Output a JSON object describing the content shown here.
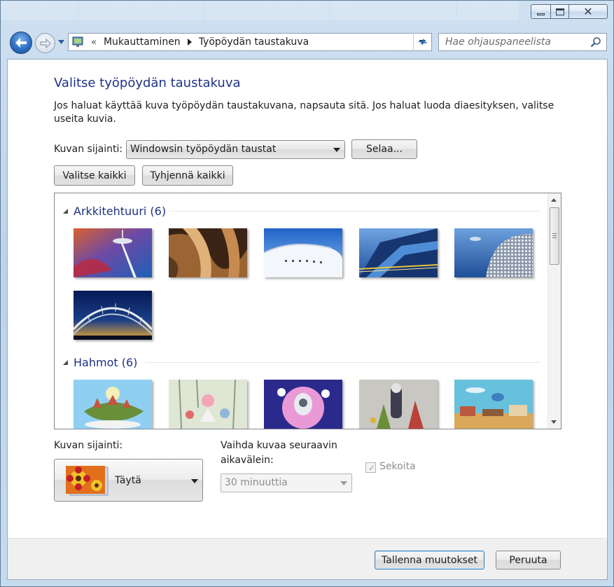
{
  "window": {
    "breadcrumb": [
      "Mukauttaminen",
      "Työpöydän taustakuva"
    ],
    "breadcrumb_overflow": "«",
    "search_placeholder": "Hae ohjauspaneelista"
  },
  "header": {
    "title": "Valitse työpöydän taustakuva",
    "description": "Jos haluat käyttää kuva työpöydän taustakuvana, napsauta sitä. Jos haluat luoda diaesityksen, valitse useita kuvia."
  },
  "location": {
    "label": "Kuvan sijainti:",
    "selected": "Windowsin työpöydän taustat",
    "browse_label": "Selaa..."
  },
  "selection": {
    "select_all": "Valitse kaikki",
    "clear_all": "Tyhjennä kaikki"
  },
  "gallery": {
    "groups": [
      {
        "title": "Arkkitehtuuri (6)",
        "thumbs": [
          "space-needle-tower",
          "curved-metal-closeup",
          "white-curved-building",
          "blue-steel-facade",
          "dotted-dome-building",
          "arched-bridge-sunset"
        ]
      },
      {
        "title": "Hahmot (6)",
        "thumbs": [
          "flying-turtle-city",
          "pastel-forest-creatures",
          "cartoon-monster-purple",
          "quirky-figures-grey",
          "flying-character-town"
        ]
      }
    ]
  },
  "bottom": {
    "position_label": "Kuvan sijainti:",
    "position_value": "Täytä",
    "interval_label_line1": "Vaihda kuvaa seuraavin",
    "interval_label_line2": "aikavälein:",
    "interval_value": "30 minuuttia",
    "shuffle_label": "Sekoita",
    "shuffle_checked": true
  },
  "footer": {
    "save_label": "Tallenna muutokset",
    "cancel_label": "Peruuta"
  },
  "colors": {
    "title_blue": "#1e3287",
    "frame_blue": "#bdd3ea"
  }
}
